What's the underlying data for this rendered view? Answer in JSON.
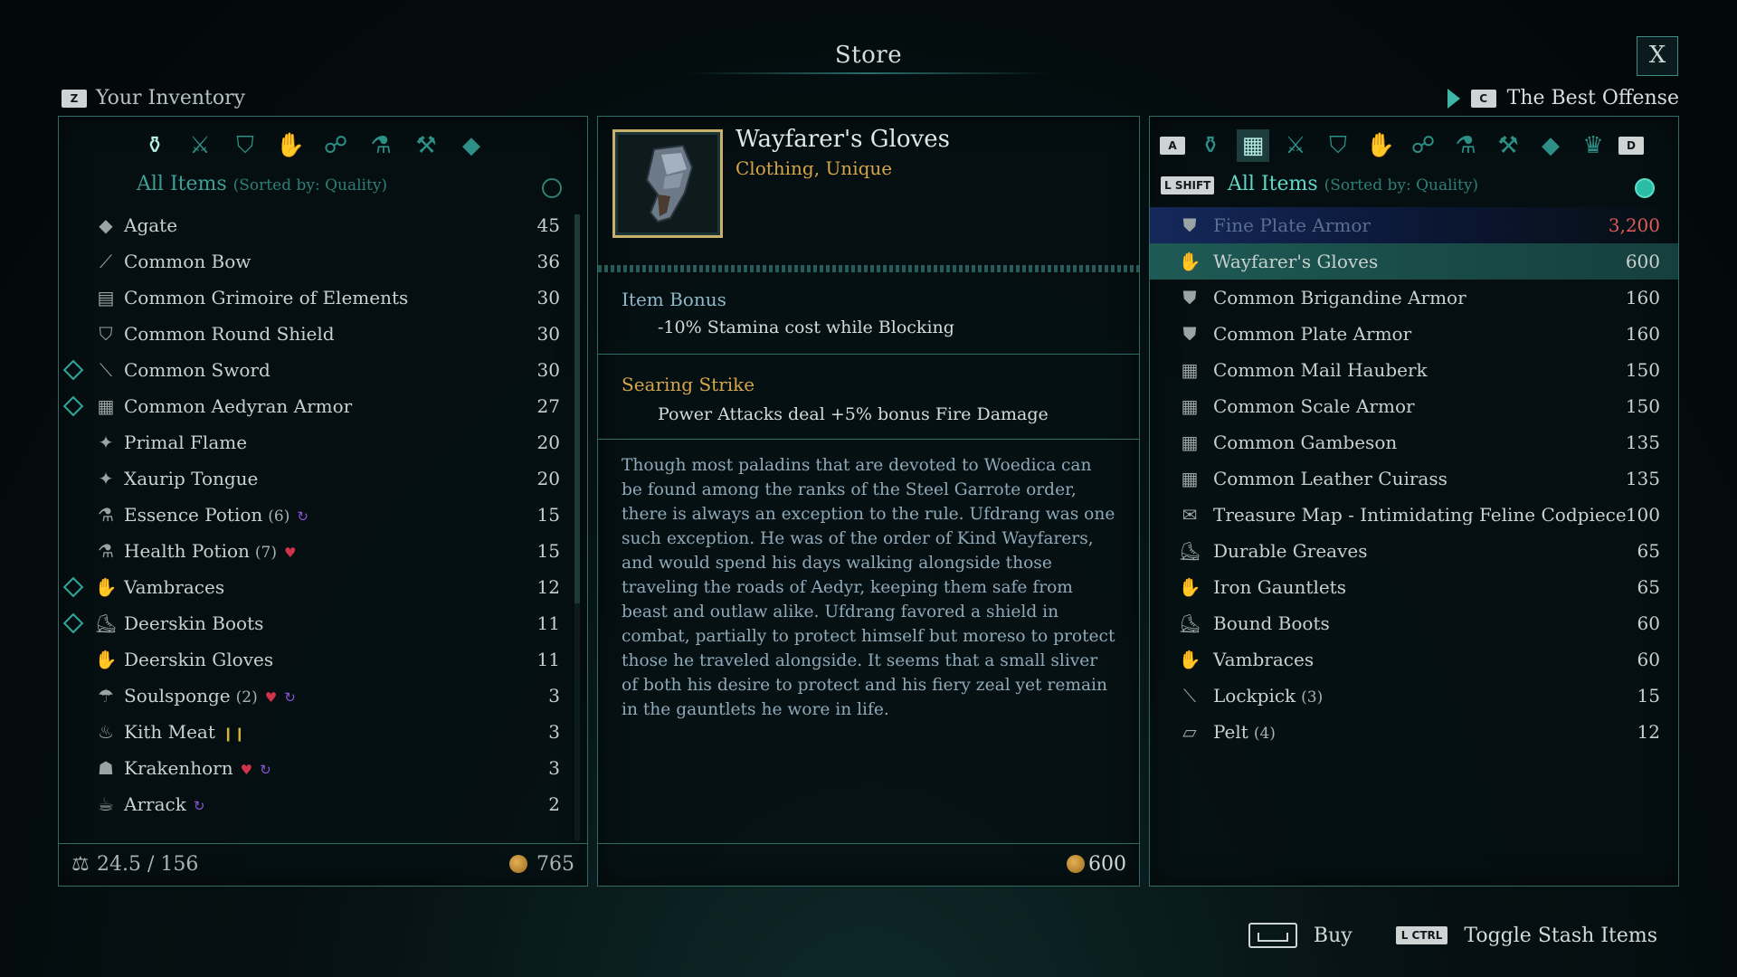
{
  "title": "Store",
  "close_label": "X",
  "left": {
    "key": "Z",
    "header": "Your Inventory",
    "sort_label": "All Items",
    "sort_sub": "(Sorted by: Quality)",
    "items": [
      {
        "icon": "◆",
        "name": "Agate",
        "qty": "",
        "count": "45",
        "new": false,
        "badges": []
      },
      {
        "icon": "⟋",
        "name": "Common Bow",
        "qty": "",
        "count": "36",
        "new": false,
        "badges": []
      },
      {
        "icon": "▤",
        "name": "Common Grimoire of Elements",
        "qty": "",
        "count": "30",
        "new": false,
        "badges": []
      },
      {
        "icon": "⛉",
        "name": "Common Round Shield",
        "qty": "",
        "count": "30",
        "new": false,
        "badges": []
      },
      {
        "icon": "⟍",
        "name": "Common Sword",
        "qty": "",
        "count": "30",
        "new": true,
        "badges": []
      },
      {
        "icon": "▦",
        "name": "Common Aedyran Armor",
        "qty": "",
        "count": "27",
        "new": true,
        "badges": []
      },
      {
        "icon": "✦",
        "name": "Primal Flame",
        "qty": "",
        "count": "20",
        "new": false,
        "badges": []
      },
      {
        "icon": "✦",
        "name": "Xaurip Tongue",
        "qty": "",
        "count": "20",
        "new": false,
        "badges": []
      },
      {
        "icon": "⚗",
        "name": "Essence Potion",
        "qty": "(6)",
        "count": "15",
        "new": false,
        "badges": [
          "essence"
        ]
      },
      {
        "icon": "⚗",
        "name": "Health Potion",
        "qty": "(7)",
        "count": "15",
        "new": false,
        "badges": [
          "heart"
        ]
      },
      {
        "icon": "✋",
        "name": "Vambraces",
        "qty": "",
        "count": "12",
        "new": true,
        "badges": []
      },
      {
        "icon": "⛸",
        "name": "Deerskin Boots",
        "qty": "",
        "count": "11",
        "new": true,
        "badges": []
      },
      {
        "icon": "✋",
        "name": "Deerskin Gloves",
        "qty": "",
        "count": "11",
        "new": false,
        "badges": []
      },
      {
        "icon": "☂",
        "name": "Soulsponge",
        "qty": "(2)",
        "count": "3",
        "new": false,
        "badges": [
          "heart",
          "essence"
        ]
      },
      {
        "icon": "♨",
        "name": "Kith Meat",
        "qty": "",
        "count": "3",
        "new": false,
        "badges": [
          "stam"
        ]
      },
      {
        "icon": "☗",
        "name": "Krakenhorn",
        "qty": "",
        "count": "3",
        "new": false,
        "badges": [
          "heart",
          "essence"
        ]
      },
      {
        "icon": "☕",
        "name": "Arrack",
        "qty": "",
        "count": "2",
        "new": false,
        "badges": [
          "essence"
        ]
      }
    ],
    "weight": "24.5 / 156",
    "gold": "765"
  },
  "middle": {
    "item_name": "Wayfarer's Gloves",
    "item_type": "Clothing, Unique",
    "bonus_title": "Item Bonus",
    "bonus_text": "-10% Stamina cost while Blocking",
    "skill_title": "Searing Strike",
    "skill_text": "Power Attacks deal +5% bonus Fire Damage",
    "lore": "Though most paladins that are devoted to Woedica can be found among the ranks of the Steel Garrote order, there is always an exception to the rule. Ufdrang was one such exception. He was of the order of Kind Wayfarers, and would spend his days walking alongside those traveling the roads of Aedyr, keeping them safe from beast and outlaw alike. Ufdrang favored a shield in combat, partially to protect himself but moreso to protect those he traveled alongside. It seems that a small sliver of both his desire to protect and his fiery zeal yet remain in the gauntlets he wore in life.",
    "price": "600"
  },
  "right": {
    "key": "C",
    "header": "The Best Offense",
    "key_a": "A",
    "key_d": "D",
    "shift_label": "L SHIFT",
    "sort_label": "All Items",
    "sort_sub": "(Sorted by: Quality)",
    "items": [
      {
        "icon": "⛊",
        "name": "Fine Plate Armor",
        "qty": "",
        "count": "3,200",
        "state": "unaffordable"
      },
      {
        "icon": "✋",
        "name": "Wayfarer's Gloves",
        "qty": "",
        "count": "600",
        "state": "selected"
      },
      {
        "icon": "⛊",
        "name": "Common Brigandine Armor",
        "qty": "",
        "count": "160",
        "state": ""
      },
      {
        "icon": "⛊",
        "name": "Common Plate Armor",
        "qty": "",
        "count": "160",
        "state": ""
      },
      {
        "icon": "▦",
        "name": "Common Mail Hauberk",
        "qty": "",
        "count": "150",
        "state": ""
      },
      {
        "icon": "▦",
        "name": "Common Scale Armor",
        "qty": "",
        "count": "150",
        "state": ""
      },
      {
        "icon": "▦",
        "name": "Common Gambeson",
        "qty": "",
        "count": "135",
        "state": ""
      },
      {
        "icon": "▦",
        "name": "Common Leather Cuirass",
        "qty": "",
        "count": "135",
        "state": ""
      },
      {
        "icon": "✉",
        "name": "Treasure Map - Intimidating Feline Codpiece",
        "qty": "",
        "count": "100",
        "state": ""
      },
      {
        "icon": "⛸",
        "name": "Durable Greaves",
        "qty": "",
        "count": "65",
        "state": ""
      },
      {
        "icon": "✋",
        "name": "Iron Gauntlets",
        "qty": "",
        "count": "65",
        "state": ""
      },
      {
        "icon": "⛸",
        "name": "Bound Boots",
        "qty": "",
        "count": "60",
        "state": ""
      },
      {
        "icon": "✋",
        "name": "Vambraces",
        "qty": "",
        "count": "60",
        "state": ""
      },
      {
        "icon": "⟍",
        "name": "Lockpick",
        "qty": "(3)",
        "count": "15",
        "state": ""
      },
      {
        "icon": "▱",
        "name": "Pelt",
        "qty": "(4)",
        "count": "12",
        "state": ""
      }
    ]
  },
  "actions": {
    "buy_label": "Buy",
    "stash_key": "L CTRL",
    "stash_label": "Toggle Stash Items"
  },
  "colors": {
    "accent": "#2f6b67",
    "gold_text": "#d5a54a",
    "selected_row": "#1e5a55",
    "price_warning": "#e05a5a"
  }
}
